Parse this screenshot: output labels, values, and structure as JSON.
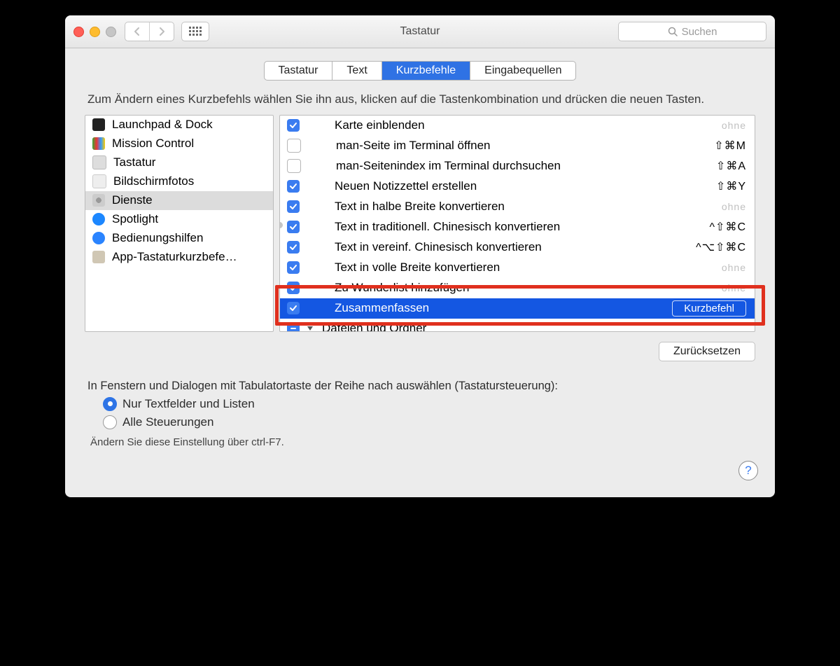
{
  "window": {
    "title": "Tastatur",
    "search_placeholder": "Suchen"
  },
  "tabs": [
    "Tastatur",
    "Text",
    "Kurzbefehle",
    "Eingabequellen"
  ],
  "active_tab": 2,
  "instructions": "Zum Ändern eines Kurzbefehls wählen Sie ihn aus, klicken auf die Tastenkombination und drücken die neuen Tasten.",
  "categories": [
    {
      "label": "Launchpad & Dock",
      "icon": "launchpad",
      "bg": "#222",
      "selected": false
    },
    {
      "label": "Mission Control",
      "icon": "mission",
      "bg": "#1f6fb3",
      "selected": false
    },
    {
      "label": "Tastatur",
      "icon": "keyboard",
      "bg": "#d9d9d9",
      "selected": false
    },
    {
      "label": "Bildschirmfotos",
      "icon": "screenshot",
      "bg": "#e8e8e8",
      "selected": false
    },
    {
      "label": "Dienste",
      "icon": "services",
      "bg": "#b9b9b9",
      "selected": true
    },
    {
      "label": "Spotlight",
      "icon": "spotlight",
      "bg": "#1c87ff",
      "selected": false
    },
    {
      "label": "Bedienungshilfen",
      "icon": "accessibility",
      "bg": "#2a84ff",
      "selected": false
    },
    {
      "label": "App-Tastaturkurzbefe…",
      "icon": "apps",
      "bg": "#d0c7b4",
      "selected": false
    }
  ],
  "shortcuts": [
    {
      "checked": true,
      "name": "Karte einblenden",
      "shortcut": "ohne",
      "none": true
    },
    {
      "checked": false,
      "name": "man-Seite im Terminal öffnen",
      "shortcut": "⇧⌘M"
    },
    {
      "checked": false,
      "name": "man-Seitenindex im Terminal durchsuchen",
      "shortcut": "⇧⌘A"
    },
    {
      "checked": true,
      "name": "Neuen Notizzettel erstellen",
      "shortcut": "⇧⌘Y"
    },
    {
      "checked": true,
      "name": "Text in halbe Breite konvertieren",
      "shortcut": "ohne",
      "none": true
    },
    {
      "checked": true,
      "name": "Text in traditionell. Chinesisch konvertieren",
      "shortcut": "^⇧⌘C"
    },
    {
      "checked": true,
      "name": "Text in vereinf. Chinesisch konvertieren",
      "shortcut": "^⌥⇧⌘C"
    },
    {
      "checked": true,
      "name": "Text in volle Breite konvertieren",
      "shortcut": "ohne",
      "none": true
    },
    {
      "checked": true,
      "name": "Zu Wunderlist hinzufügen",
      "shortcut": "ohne",
      "none": true
    },
    {
      "checked": true,
      "name": "Zusammenfassen",
      "shortcut_label": "Kurzbefehl",
      "selected": true
    }
  ],
  "group_row": {
    "name": "Dateien und Ordner"
  },
  "reset_button": "Zurücksetzen",
  "radio": {
    "prompt": "In Fenstern und Dialogen mit Tabulatortaste der Reihe nach auswählen (Tastatursteuerung):",
    "opt1": "Nur Textfelder und Listen",
    "opt2": "Alle Steuerungen",
    "footnote": "Ändern Sie diese Einstellung über ctrl-F7."
  },
  "help": "?"
}
